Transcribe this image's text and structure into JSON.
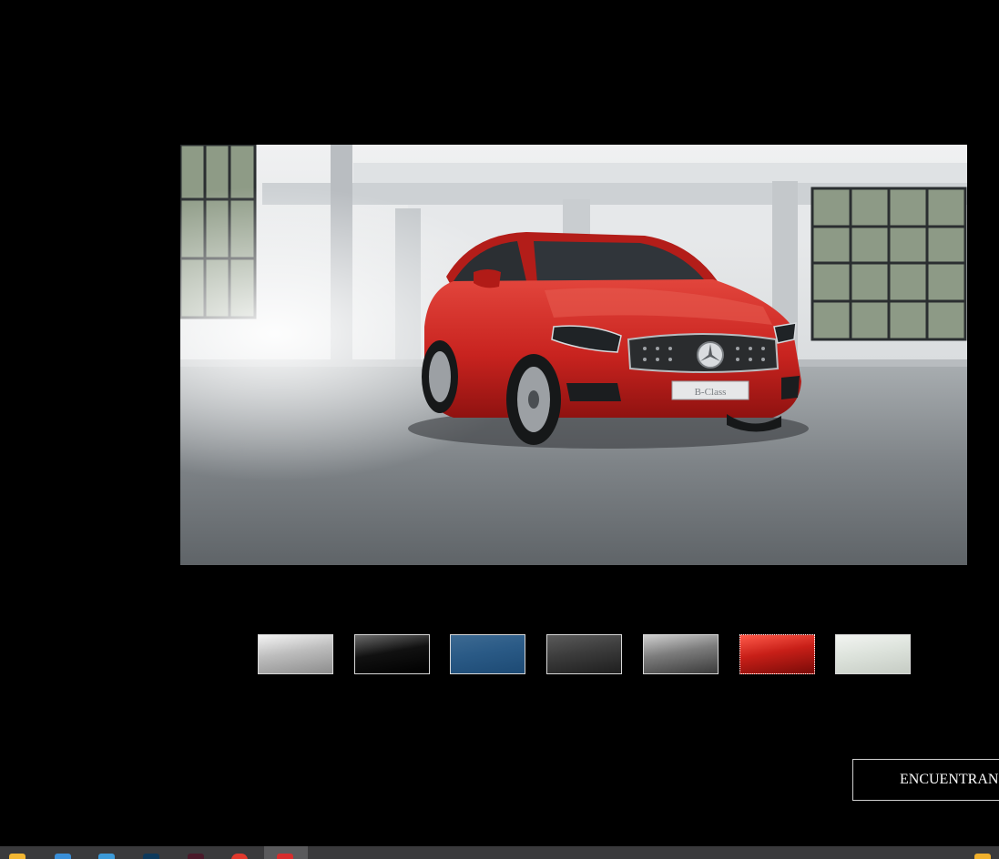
{
  "scene": {
    "badge_text": "B-Class",
    "body_color": "#c8231f"
  },
  "swatches": [
    {
      "name": "silver",
      "top": "#f4f4f4",
      "mid": "#bdbdbd",
      "bottom": "#8d8d8d",
      "selected": false
    },
    {
      "name": "black",
      "top": "#6a6a6a",
      "mid": "#111111",
      "bottom": "#000000",
      "selected": false
    },
    {
      "name": "blue",
      "top": "#3d6a92",
      "mid": "#2a5a86",
      "bottom": "#1d4a74",
      "selected": false
    },
    {
      "name": "graphite",
      "top": "#5a5a5a",
      "mid": "#3c3c3c",
      "bottom": "#1e1e1e",
      "selected": false
    },
    {
      "name": "grey",
      "top": "#cfcfcf",
      "mid": "#7c7c7c",
      "bottom": "#3a3a3a",
      "selected": false
    },
    {
      "name": "red",
      "top": "#ff5a4a",
      "mid": "#c81f18",
      "bottom": "#7a0b08",
      "selected": true
    },
    {
      "name": "white",
      "top": "#f2f4f1",
      "mid": "#dde3dc",
      "bottom": "#c6ccc4",
      "selected": false
    }
  ],
  "cta": {
    "label": "ENCUENTRAN"
  },
  "taskbar": {
    "icons": [
      {
        "name": "file-explorer-icon",
        "color": "#f2b632"
      },
      {
        "name": "store-icon",
        "color": "#3a8fd8"
      },
      {
        "name": "edge-icon",
        "color": "#3c9ad8"
      },
      {
        "name": "photoshop-icon",
        "color": "#0e3a5c"
      },
      {
        "name": "illustrator-icon",
        "color": "#4a1a2a"
      },
      {
        "name": "chrome-icon",
        "color": "#e0392d"
      },
      {
        "name": "app-icon",
        "color": "#d62d2d"
      }
    ]
  }
}
